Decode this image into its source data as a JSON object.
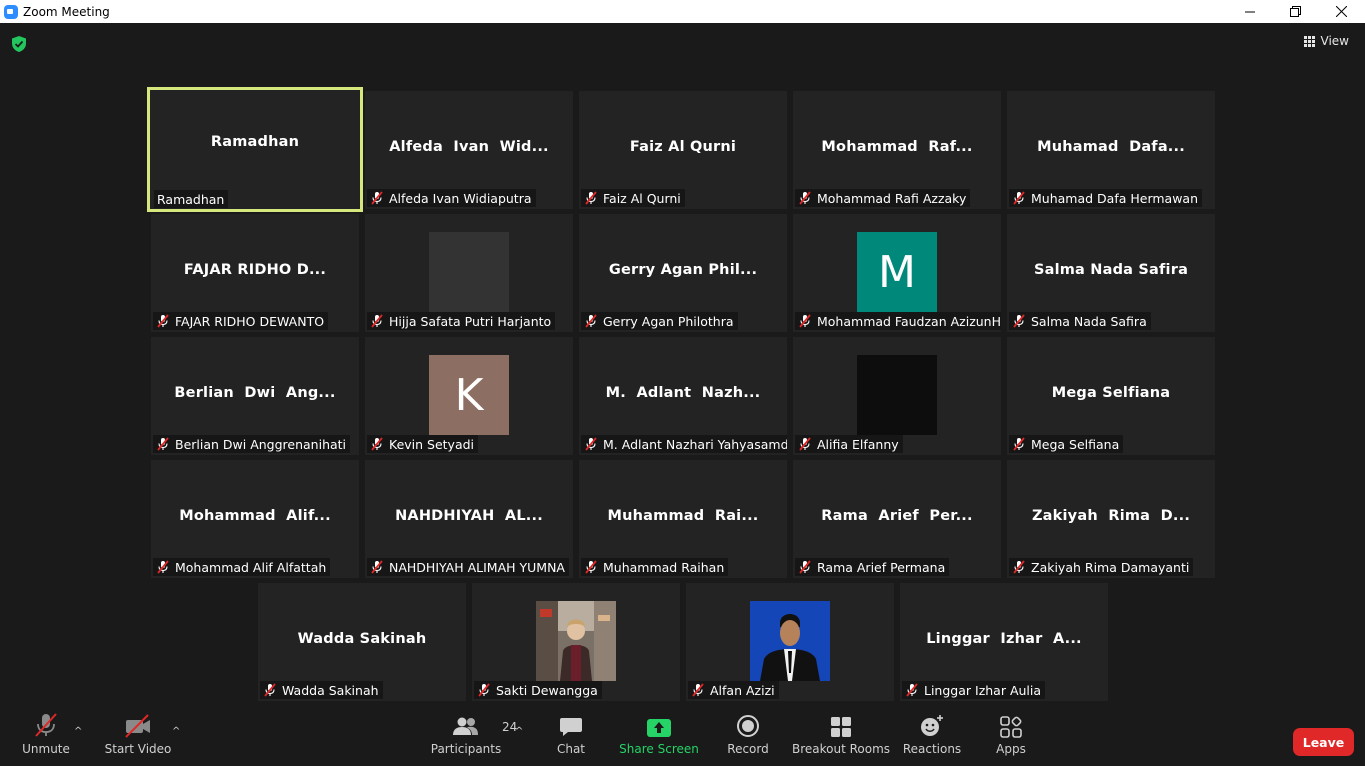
{
  "window": {
    "title": "Zoom Meeting"
  },
  "view_button": {
    "label": "View"
  },
  "participants": [
    {
      "big": "Ramadhan",
      "label": "Ramadhan",
      "muted": false,
      "active": true
    },
    {
      "big": "Alfeda  Ivan  Wid...",
      "label": "Alfeda Ivan Widiaputra",
      "muted": true
    },
    {
      "big": "Faiz Al Qurni",
      "label": "Faiz Al Qurni",
      "muted": true
    },
    {
      "big": "Mohammad  Raf...",
      "label": "Mohammad Rafi Azzaky",
      "muted": true
    },
    {
      "big": "Muhamad  Dafa...",
      "label": "Muhamad Dafa Hermawan",
      "muted": true
    },
    {
      "big": "FAJAR RIDHO D...",
      "label": "FAJAR RIDHO DEWANTO",
      "muted": true
    },
    {
      "big": "",
      "label": "Hijja Safata Putri Harjanto",
      "muted": true,
      "avatar": "gray"
    },
    {
      "big": "Gerry Agan Phil...",
      "label": "Gerry Agan Philothra",
      "muted": true
    },
    {
      "big": "",
      "label": "Mohammad Faudzan AzizunH...",
      "muted": true,
      "avatar": "M"
    },
    {
      "big": "Salma Nada Safira",
      "label": "Salma Nada Safira",
      "muted": true
    },
    {
      "big": "Berlian  Dwi  Ang...",
      "label": "Berlian Dwi Anggrenanihati",
      "muted": true
    },
    {
      "big": "",
      "label": "Kevin Setyadi",
      "muted": true,
      "avatar": "K"
    },
    {
      "big": "M.  Adlant  Nazh...",
      "label": "M. Adlant Nazhari Yahyasamd...",
      "muted": true
    },
    {
      "big": "",
      "label": "Alifia Elfanny",
      "muted": true,
      "avatar": "black"
    },
    {
      "big": "Mega Selfiana",
      "label": "Mega Selfiana",
      "muted": true
    },
    {
      "big": "Mohammad  Alif...",
      "label": "Mohammad Alif Alfattah",
      "muted": true
    },
    {
      "big": "NAHDHIYAH  AL...",
      "label": "NAHDHIYAH ALIMAH YUMNA",
      "muted": true
    },
    {
      "big": "Muhammad  Rai...",
      "label": "Muhammad Raihan",
      "muted": true
    },
    {
      "big": "Rama  Arief  Per...",
      "label": "Rama Arief Permana",
      "muted": true
    },
    {
      "big": "Zakiyah  Rima  D...",
      "label": "Zakiyah Rima Damayanti",
      "muted": true
    },
    {
      "big": "Wadda Sakinah",
      "label": "Wadda Sakinah",
      "muted": true
    },
    {
      "big": "",
      "label": "Sakti Dewangga",
      "muted": true,
      "avatar": "photo-street"
    },
    {
      "big": "",
      "label": "Alfan Azizi",
      "muted": true,
      "avatar": "photo-portrait"
    },
    {
      "big": "Linggar  Izhar  A...",
      "label": "Linggar Izhar Aulia",
      "muted": true
    }
  ],
  "toolbar": {
    "unmute": "Unmute",
    "start_video": "Start Video",
    "participants": "Participants",
    "participants_count": "24",
    "chat": "Chat",
    "share_screen": "Share Screen",
    "record": "Record",
    "breakout_rooms": "Breakout Rooms",
    "reactions": "Reactions",
    "apps": "Apps",
    "leave": "Leave"
  },
  "colors": {
    "active_speaker_border": "#d4e87e",
    "share_green": "#25d366",
    "leave_red": "#e02828",
    "avatar_m": "#00897b",
    "avatar_k": "#8d6e63"
  }
}
